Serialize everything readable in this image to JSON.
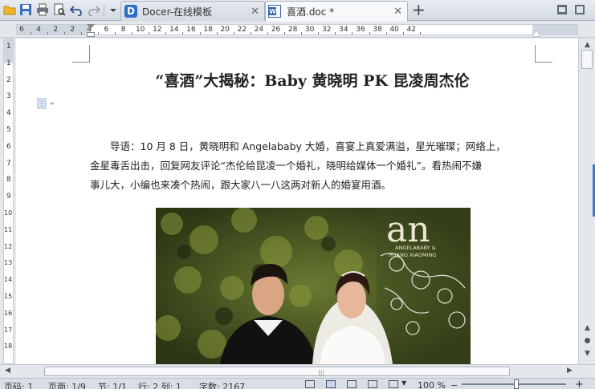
{
  "toolbar": {
    "icons": [
      "app-menu-icon",
      "save-icon",
      "print-icon",
      "print-preview-icon",
      "undo-icon",
      "redo-icon",
      "customize-toolbar-icon"
    ]
  },
  "tabs": [
    {
      "label": "Docer-在线模板",
      "icon": "docer-icon",
      "active": false
    },
    {
      "label": "喜酒.doc *",
      "icon": "word-doc-icon",
      "active": true
    }
  ],
  "new_tab_symbol": "+",
  "close_symbol": "✕",
  "ruler": {
    "numbers": [
      "6",
      "4",
      "2",
      "2",
      "4",
      "6",
      "8",
      "10",
      "12",
      "14",
      "16",
      "18",
      "20",
      "22",
      "24",
      "26",
      "28",
      "30",
      "32",
      "34",
      "36",
      "38",
      "40",
      "42"
    ],
    "corner_label": "L"
  },
  "vruler": {
    "numbers": [
      "1",
      "1",
      "2",
      "3",
      "4",
      "5",
      "6",
      "7",
      "8",
      "9",
      "10",
      "11",
      "12",
      "13",
      "14",
      "15",
      "16",
      "17",
      "18"
    ]
  },
  "document": {
    "title": "“喜酒”大揭秘：Baby 黄晓明 PK 昆凌周杰伦",
    "paragraph_lines": [
      "　　导语：10 月 8 日，黄晓明和 Angelababy 大婚，喜宴上真爱满溢，星光璀璨；网络上，",
      "金星毒舌出击，回复网友评论“杰伦给昆凌一个婚礼，晓明给媒体一个婚礼”。看热闹不嫌",
      "事儿大，小编也来凑个热闹，跟大家八一八这两对新人的婚宴用酒。"
    ],
    "photo": {
      "sign_big": "an",
      "sign_line1": "ANGELABABY &",
      "sign_line2": "HUANG XIAOMING"
    }
  },
  "statusbar": {
    "page_no": "页码: 1",
    "pages": "页面: 1/9",
    "section": "节: 1/1",
    "row_col": "行: 2  列: 1",
    "word_count": "字数: 2167",
    "zoom": "100 %",
    "minus": "−",
    "plus": "+"
  },
  "colors": {
    "accent": "#3b79c8",
    "tab_active": "#f6f8fa"
  }
}
